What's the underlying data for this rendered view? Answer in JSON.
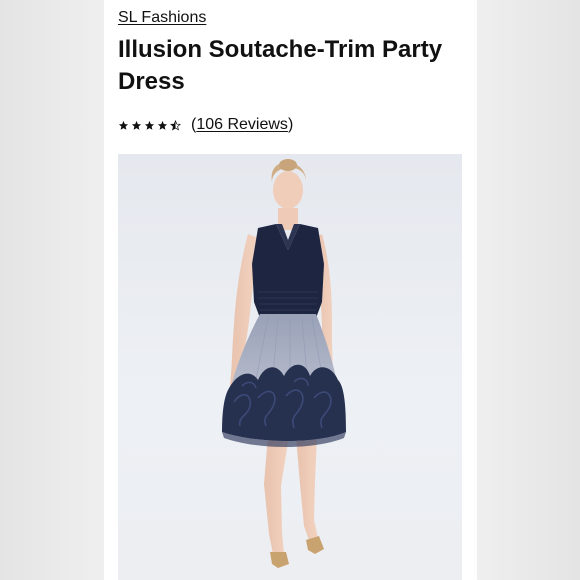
{
  "product": {
    "brand": "SL Fashions",
    "title": "Illusion Soutache-Trim Party Dress",
    "rating": 4.5,
    "rating_max": 5,
    "reviews_label": "106 Reviews"
  },
  "colors": {
    "dress": "#1e2540",
    "skirt_tulle": "#c9cfe0",
    "background": "#ffffff",
    "page_side": "#e9e9e9"
  },
  "icons": {
    "star_full": "star-icon",
    "star_half": "star-half-icon"
  }
}
